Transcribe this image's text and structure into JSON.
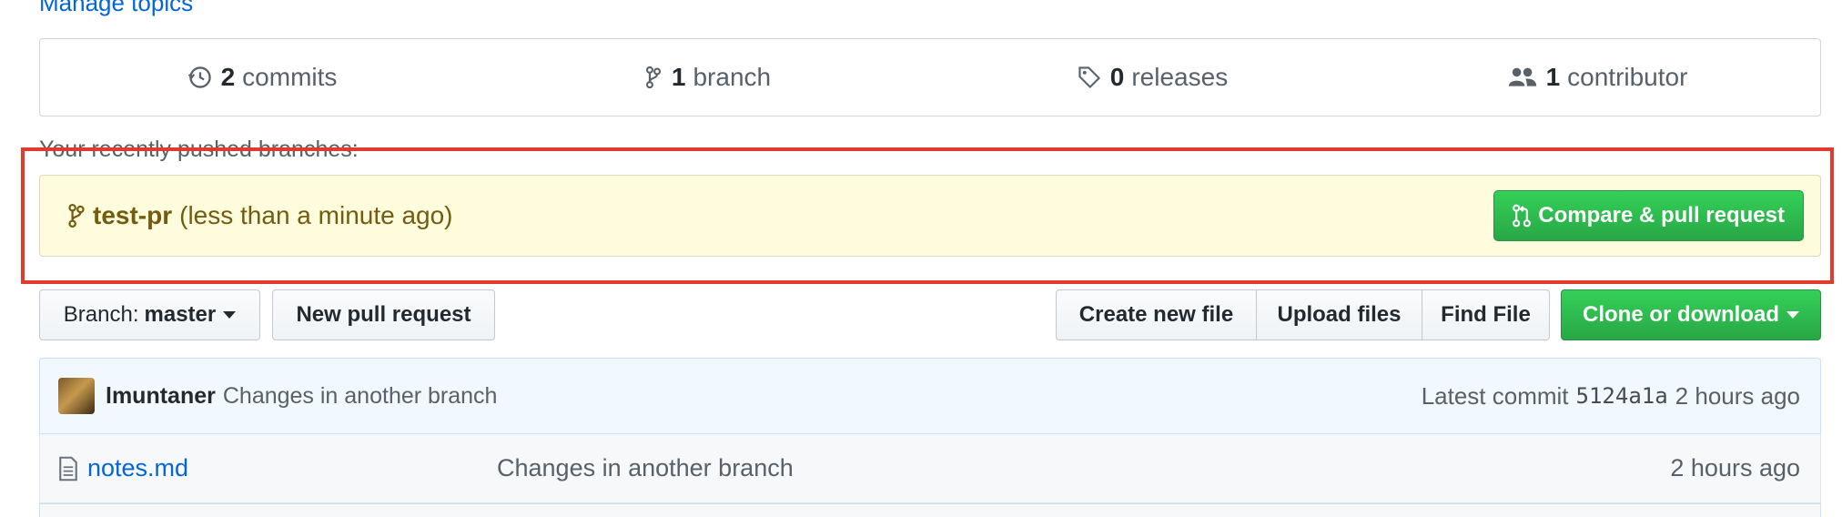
{
  "top_link": "Manage topics",
  "summary": {
    "commits": {
      "count": "2",
      "label": "commits",
      "icon": "history-icon"
    },
    "branches": {
      "count": "1",
      "label": "branch",
      "icon": "git-branch-icon"
    },
    "releases": {
      "count": "0",
      "label": "releases",
      "icon": "tag-icon"
    },
    "contributors": {
      "count": "1",
      "label": "contributor",
      "icon": "people-icon"
    }
  },
  "recent_branches": {
    "label": "Your recently pushed branches:",
    "branch_name": "test-pr",
    "time": "(less than a minute ago)",
    "compare_button": "Compare & pull request"
  },
  "file_nav": {
    "branch_prefix": "Branch:",
    "branch_value": "master",
    "new_pull_request": "New pull request",
    "create_new_file": "Create new file",
    "upload_files": "Upload files",
    "find_file": "Find File",
    "clone_or_download": "Clone or download"
  },
  "latest_commit": {
    "author": "lmuntaner",
    "message": "Changes in another branch",
    "label": "Latest commit",
    "sha": "5124a1a",
    "age": "2 hours ago"
  },
  "files": [
    {
      "name": "notes.md",
      "message": "Changes in another branch",
      "age": "2 hours ago",
      "icon": "file-icon"
    }
  ],
  "colors": {
    "highlight_border": "#e23b2e",
    "primary_green": "#28a745",
    "link_blue": "#0366d6",
    "recent_branch_bg": "#fffbdd"
  }
}
